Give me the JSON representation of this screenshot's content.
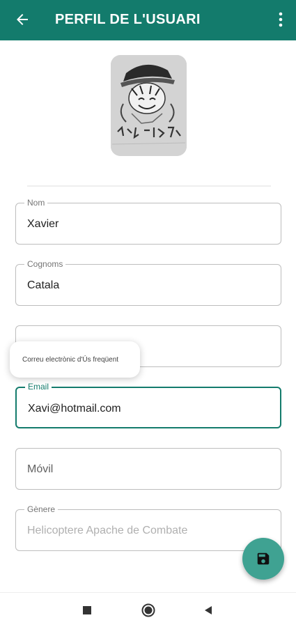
{
  "app_bar": {
    "title": "PERFIL DE L'USUARI",
    "back_icon": "arrow-left-icon",
    "menu_icon": "more-vert-icon",
    "color": "#137b6c"
  },
  "avatar": {
    "icon": "profile-photo-manga-sketch"
  },
  "fields": {
    "nom": {
      "label": "Nom",
      "value": "Xavier"
    },
    "cognoms": {
      "label": "Cognoms",
      "value": "Catala"
    },
    "email_frequent": {
      "label": "",
      "value": ""
    },
    "email": {
      "label": "Email",
      "value": "Xavi@hotmail.com"
    },
    "movil": {
      "label": "",
      "value": "",
      "placeholder": "Móvil"
    },
    "genere": {
      "label": "Gènere",
      "value": "",
      "placeholder": "Helicoptere Apache de Combate"
    }
  },
  "tooltip": {
    "text": "Correu electrònic d'Ús freqüent"
  },
  "fab": {
    "icon": "save-icon",
    "color": "#3fa292"
  },
  "nav_bar": {
    "icons": [
      "square-recents-icon",
      "circle-home-icon",
      "triangle-back-icon"
    ]
  }
}
